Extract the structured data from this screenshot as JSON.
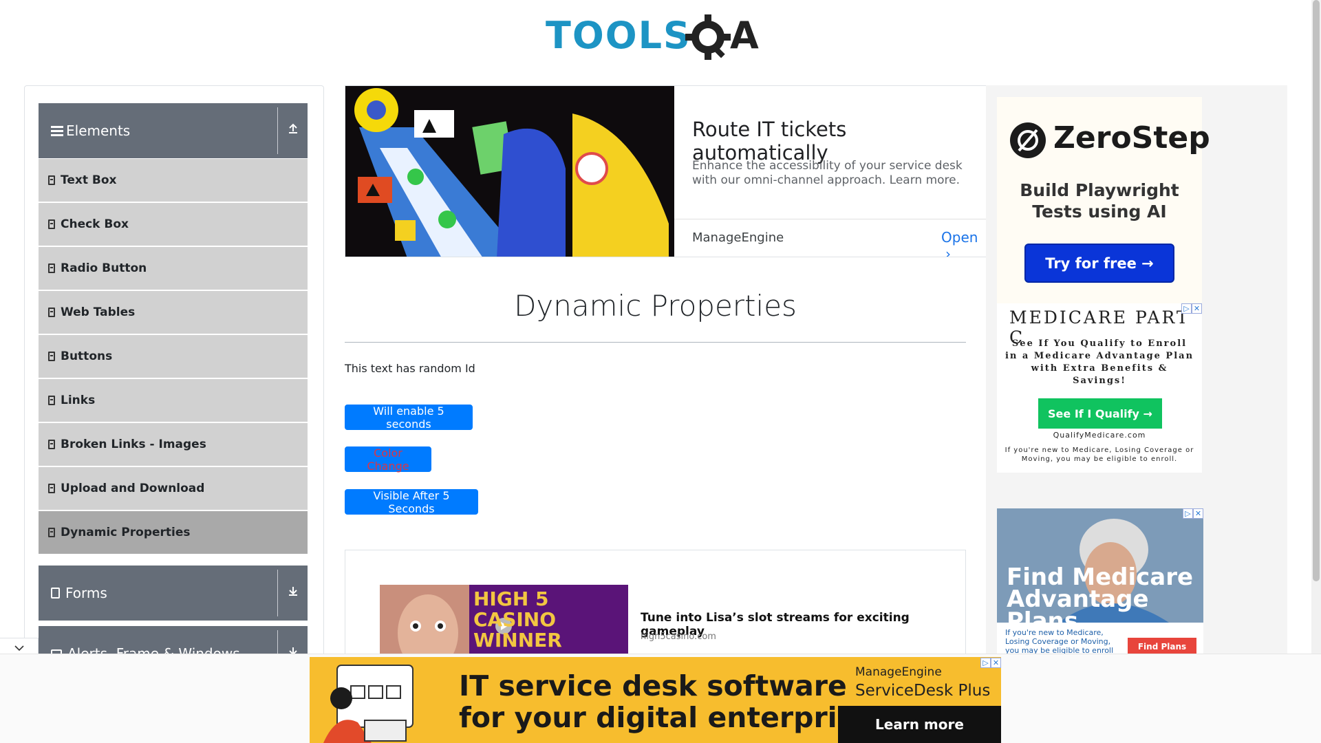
{
  "brand": {
    "logo_alt": "ToolsQA"
  },
  "sidebar": {
    "elements_group": {
      "label": "Elements"
    },
    "items": [
      {
        "label": "Text Box"
      },
      {
        "label": "Check Box"
      },
      {
        "label": "Radio Button"
      },
      {
        "label": "Web Tables"
      },
      {
        "label": "Buttons"
      },
      {
        "label": "Links"
      },
      {
        "label": "Broken Links - Images"
      },
      {
        "label": "Upload and Download"
      },
      {
        "label": "Dynamic Properties",
        "active": true
      }
    ],
    "forms_group": {
      "label": "Forms"
    },
    "alerts_group": {
      "label": "Alerts, Frame & Windows"
    }
  },
  "top_ad": {
    "title": "Route IT tickets automatically",
    "description": "Enhance the accessibility of your service desk with our omni-channel approach. Learn more.",
    "advertiser": "ManageEngine",
    "cta": "Open"
  },
  "main": {
    "title": "Dynamic Properties",
    "random_id_text": "This text has random Id",
    "buttons": {
      "enable": "Will enable 5 seconds",
      "color": "Color Change",
      "visible": "Visible After 5 Seconds"
    }
  },
  "content_ad": {
    "image_text": "HIGH 5 CASINO WINNER",
    "title": "Tune into Lisa’s slot streams for exciting gameplay",
    "source": "high5casino.com"
  },
  "right_ads": {
    "zerostep": {
      "logo": "ZeroStep",
      "headline": "Build Playwright Tests using AI",
      "cta": "Try for free →"
    },
    "medicare1": {
      "title": "MEDICARE PART C",
      "body": "See If You Qualify to Enroll in a Medicare Advantage Plan with Extra Benefits & Savings!",
      "cta": "See If I Qualify →",
      "site": "QualifyMedicare.com",
      "fine": "If you're new to Medicare, Losing Coverage or Moving, you may be eligible to enroll."
    },
    "medicare2": {
      "headline": "Find Medicare Advantage Plans",
      "fine": "If you're new to Medicare, Losing Coverage or Moving, you may be eligible to enroll in",
      "cta": "Find Plans"
    }
  },
  "bottom_ad": {
    "line1": "IT service desk software",
    "line2": "for your digital enterprise",
    "brand1": "ManageEngine",
    "brand2": "ServiceDesk Plus",
    "cta": "Learn more"
  },
  "colors": {
    "primary_button": "#007bff",
    "sidebar_header": "#656d78",
    "sidebar_item": "#d1d1d1",
    "sidebar_active": "#a9a9a9",
    "logo_blue": "#1d94c4",
    "color_change_text": "#dc3545"
  }
}
